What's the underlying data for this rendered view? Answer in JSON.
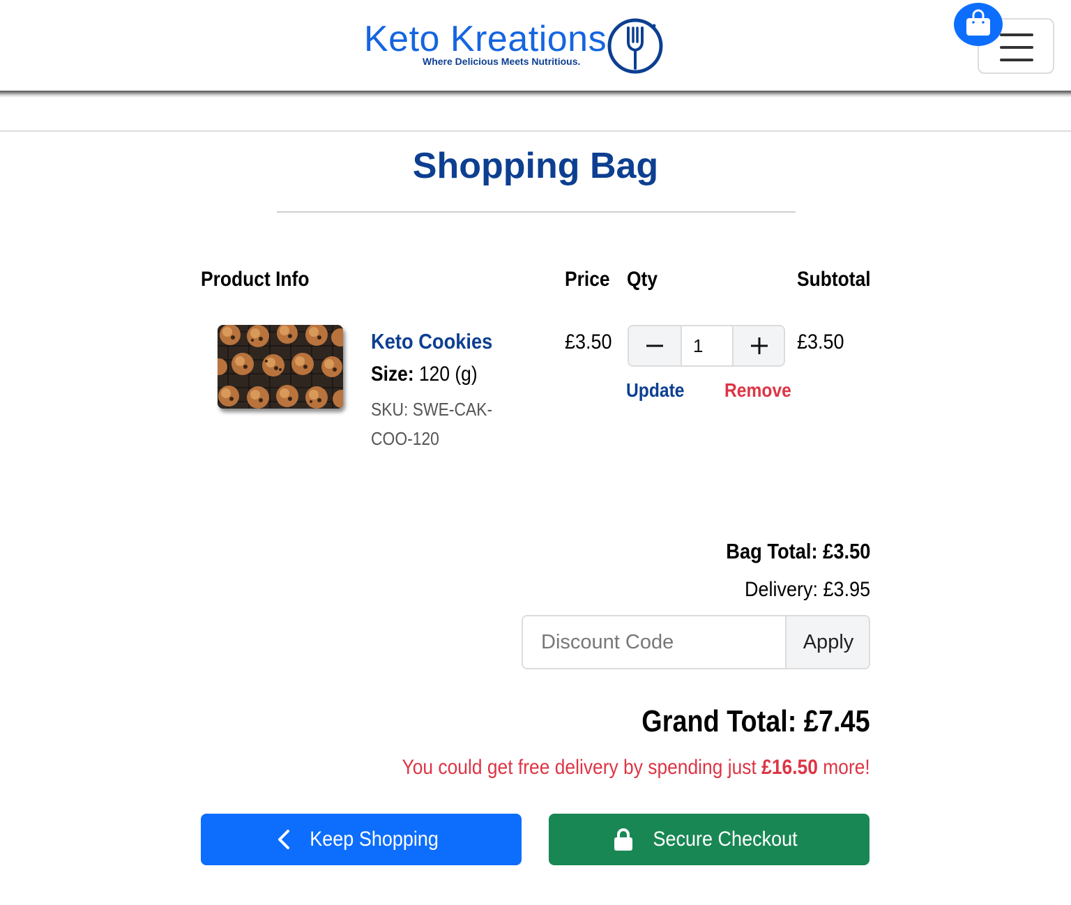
{
  "header": {
    "logo_name": "Keto Kreations",
    "logo_tagline": "Where Delicious Meets Nutritious.",
    "icons": [
      "fork-icon",
      "shopping-bag-icon",
      "hamburger-menu-icon"
    ]
  },
  "page": {
    "title": "Shopping Bag"
  },
  "table": {
    "headers": {
      "product_info": "Product Info",
      "price": "Price",
      "qty": "Qty",
      "subtotal": "Subtotal"
    },
    "items": [
      {
        "name": "Keto Cookies",
        "size_label": "Size:",
        "size_value": "120 (g)",
        "sku": "SKU: SWE-CAK-COO-120",
        "price": "£3.50",
        "quantity": "1",
        "subtotal": "£3.50",
        "update_label": "Update",
        "remove_label": "Remove"
      }
    ]
  },
  "summary": {
    "bag_total": "Bag Total: £3.50",
    "delivery": "Delivery: £3.95",
    "discount_placeholder": "Discount Code",
    "apply_label": "Apply",
    "grand_total": "Grand Total: £7.45",
    "free_delivery_prefix": "You could get free delivery by spending just",
    "free_delivery_amount": "£16.50",
    "free_delivery_suffix": "more!"
  },
  "actions": {
    "keep_shopping": "Keep Shopping",
    "secure_checkout": "Secure Checkout"
  },
  "colors": {
    "brand_blue": "#1565e0",
    "dark_blue": "#0d3f91",
    "primary": "#0d6efd",
    "success": "#198754",
    "danger": "#dc3545"
  }
}
